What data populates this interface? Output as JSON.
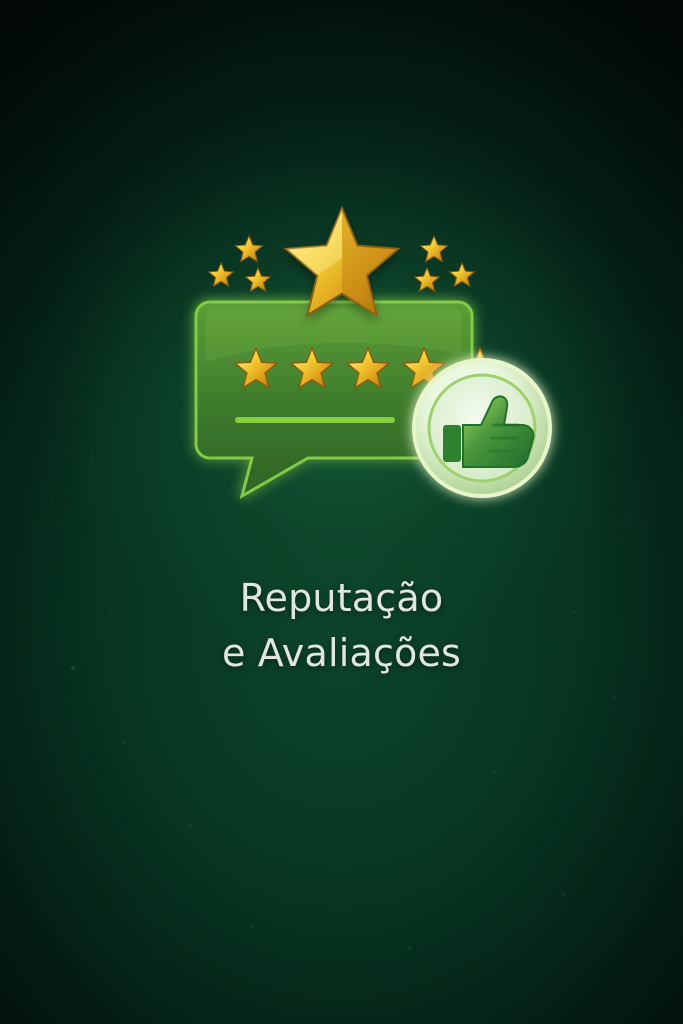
{
  "title": {
    "line1": "Reputação",
    "line2": "e Avaliações"
  },
  "illustration": {
    "icons": [
      "sparkle-star-icon",
      "large-star-icon",
      "speech-bubble-icon",
      "rating-star-icon",
      "thumbs-up-icon"
    ],
    "rating": {
      "value": 5,
      "max": 5
    }
  },
  "colors": {
    "background_dark": "#03110c",
    "background_green": "#0c442b",
    "bubble_green": "#4f8f2e",
    "bubble_highlight": "#78bf3f",
    "gold": "#f2c62a",
    "title": "#e2e7de"
  }
}
